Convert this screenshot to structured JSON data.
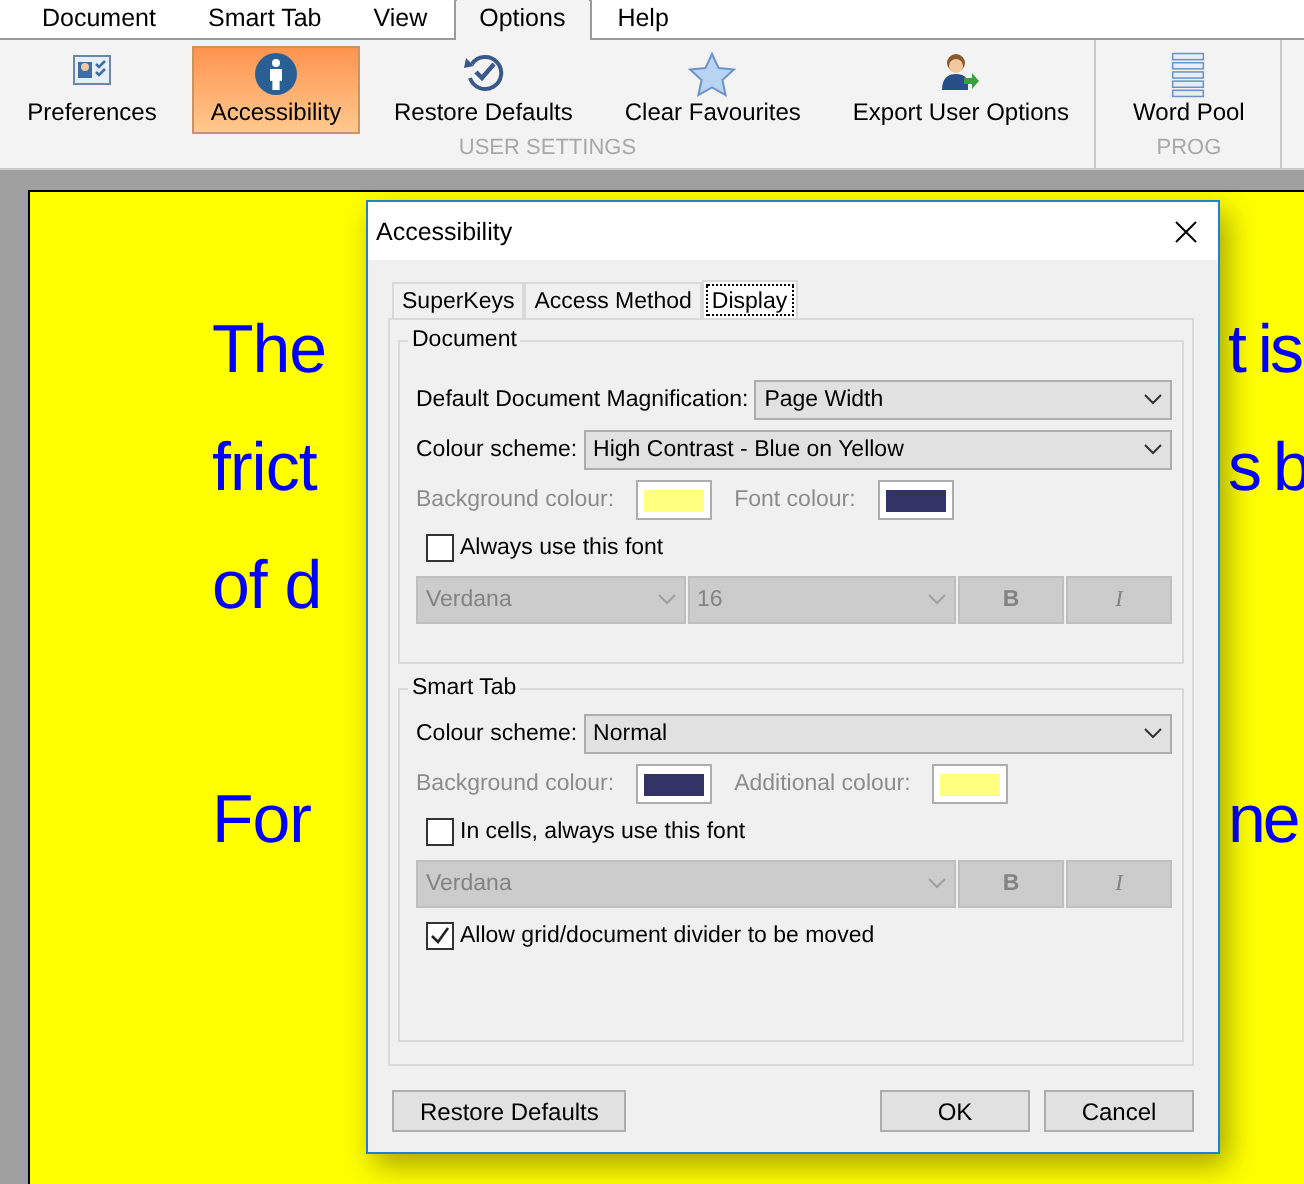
{
  "menu_tabs": [
    {
      "label": "Document",
      "selected": false
    },
    {
      "label": "Smart Tab",
      "selected": false
    },
    {
      "label": "View",
      "selected": false
    },
    {
      "label": "Options",
      "selected": true
    },
    {
      "label": "Help",
      "selected": false
    }
  ],
  "ribbon": {
    "groups": [
      {
        "label": "USER SETTINGS",
        "buttons": [
          {
            "label": "Preferences",
            "selected": false
          },
          {
            "label": "Accessibility",
            "selected": true
          },
          {
            "label": "Restore Defaults",
            "selected": false
          },
          {
            "label": "Clear Favourites",
            "selected": false
          },
          {
            "label": "Export User Options",
            "selected": false
          }
        ]
      },
      {
        "label": "PROG",
        "buttons": [
          {
            "label": "Word Pool",
            "selected": false
          }
        ]
      }
    ]
  },
  "document": {
    "paragraphs": [
      {
        "lines": [
          {
            "left": "The",
            "right": "t is"
          },
          {
            "left": "frict",
            "right": "s b"
          },
          {
            "left": "of d"
          }
        ]
      },
      {
        "lines": [
          {
            "left": "For",
            "right": "ne"
          }
        ]
      }
    ]
  },
  "dialog": {
    "title": "Accessibility",
    "tabs": [
      {
        "label": "SuperKeys",
        "selected": false
      },
      {
        "label": "Access Method",
        "selected": false
      },
      {
        "label": "Display",
        "selected": true
      }
    ],
    "sections": [
      {
        "title": "Document",
        "items": [
          {
            "kind": "select",
            "label": "Default Document Magnification:",
            "value": "Page Width"
          },
          {
            "kind": "select",
            "label": "Colour scheme:",
            "value": "High Contrast - Blue on Yellow"
          },
          {
            "kind": "swatches",
            "disabled": true,
            "swatches": [
              {
                "label": "Background colour:",
                "color": "#ffff80"
              },
              {
                "label": "Font colour:",
                "color": "#333366"
              }
            ]
          },
          {
            "kind": "checkbox",
            "label": "Always use this font",
            "checked": false
          },
          {
            "kind": "font_row",
            "disabled": true,
            "font": "Verdana",
            "size": "16",
            "bold": "B",
            "italic": "I"
          }
        ]
      },
      {
        "title": "Smart Tab",
        "items": [
          {
            "kind": "select",
            "label": "Colour scheme:",
            "value": "Normal"
          },
          {
            "kind": "swatches",
            "disabled": true,
            "swatches": [
              {
                "label": "Background colour:",
                "color": "#333366"
              },
              {
                "label": "Additional colour:",
                "color": "#ffff80"
              }
            ]
          },
          {
            "kind": "checkbox",
            "label": "In cells, always use this font",
            "checked": false
          },
          {
            "kind": "font_row",
            "disabled": true,
            "font": "Verdana",
            "bold": "B",
            "italic": "I"
          },
          {
            "kind": "checkbox",
            "label": "Allow grid/document divider to be moved",
            "checked": true
          }
        ]
      }
    ],
    "buttons": {
      "left": "Restore Defaults",
      "right": [
        "OK",
        "Cancel"
      ]
    }
  }
}
